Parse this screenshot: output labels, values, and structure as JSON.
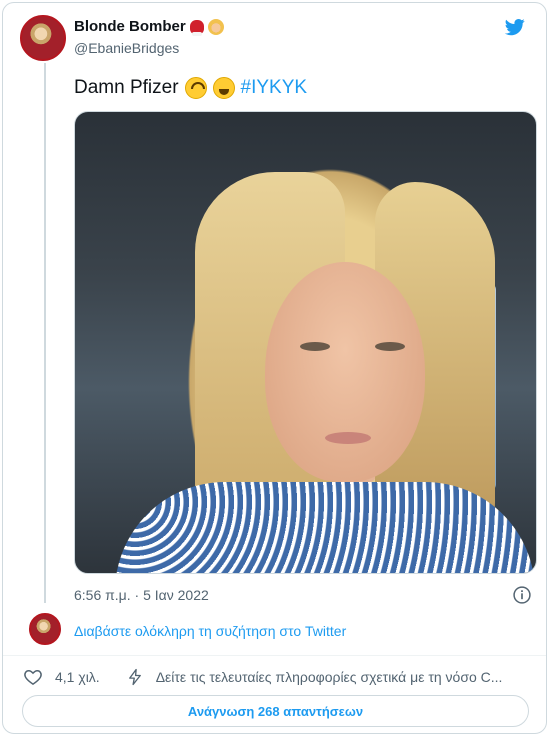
{
  "author": {
    "display_name": "Blonde Bomber",
    "badges": [
      "boxing-glove-emoji",
      "woman-tipping-hand-emoji"
    ],
    "handle": "@EbanieBridges"
  },
  "tweet": {
    "text": "Damn Pfizer",
    "emojis": [
      "upside-down-face-emoji",
      "grinning-squinting-face-emoji"
    ],
    "hashtag": "#IYKYK",
    "timestamp": "6:56 π.μ. · 5 Ιαν 2022"
  },
  "thread": {
    "read_conversation": "Διαβάστε ολόκληρη τη συζήτηση στο Twitter"
  },
  "actions": {
    "likes": "4,1 χιλ.",
    "news_link": "Δείτε τις τελευταίες πληροφορίες σχετικά με τη νόσο C...",
    "read_replies": "Ανάγνωση 268 απαντήσεων"
  },
  "colors": {
    "accent": "#1d9bf0",
    "text_primary": "#0f1419",
    "text_secondary": "#536471",
    "border": "#cfd9de"
  }
}
